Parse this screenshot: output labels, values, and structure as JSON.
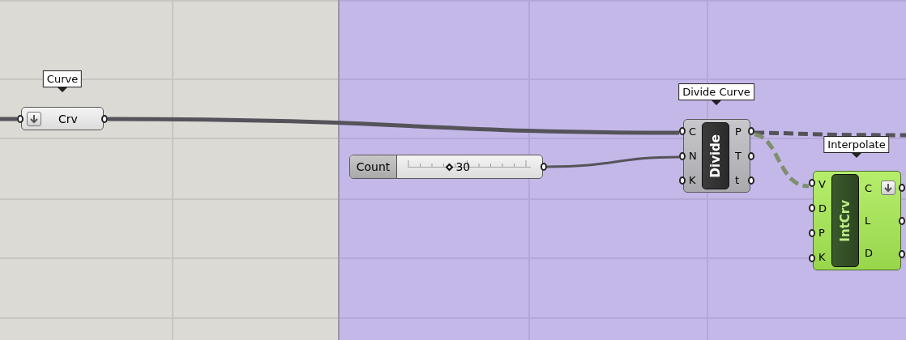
{
  "nodes": [
    {
      "kind": "param",
      "tooltip": "Curve",
      "label": "Crv",
      "arrow": true,
      "selected": false
    },
    {
      "kind": "slider",
      "label": "Count",
      "value": "30",
      "level": 0.34,
      "selected": false
    },
    {
      "kind": "component",
      "tooltip": "Divide Curve",
      "nickname": "Divide",
      "inputs": [
        "C",
        "N",
        "K"
      ],
      "outputs": [
        "P",
        "T",
        "t"
      ],
      "output_arrow": false,
      "selected": false
    },
    {
      "kind": "component",
      "tooltip": "Interpolate",
      "nickname": "IntCrv",
      "inputs": [
        "V",
        "D",
        "P",
        "K"
      ],
      "outputs": [
        "C",
        "L",
        "D"
      ],
      "output_arrow": true,
      "selected": true
    }
  ],
  "wires": [
    {
      "kind": "solid"
    },
    {
      "kind": "solid"
    },
    {
      "kind": "thin"
    },
    {
      "kind": "dashed"
    },
    {
      "kind": "dashed-selected"
    }
  ]
}
